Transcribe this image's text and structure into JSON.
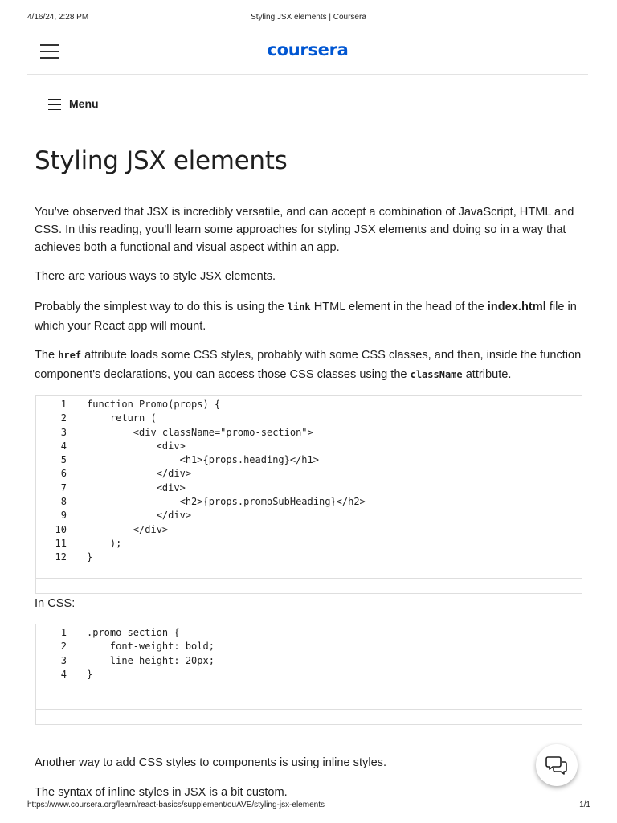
{
  "print_header": {
    "date": "4/16/24, 2:28 PM",
    "title": "Styling JSX elements | Coursera"
  },
  "brand": {
    "logo_text": "coursera",
    "color": "#0056d2"
  },
  "menu": {
    "label": "Menu"
  },
  "page_title": "Styling JSX elements",
  "paragraphs": {
    "p1": "You’ve observed that JSX is incredibly versatile, and can accept a combination of JavaScript, HTML and CSS.  In this reading, you'll learn some approaches for styling JSX elements and doing so in a way that achieves both a functional and visual aspect within an app.",
    "p2": "There are various ways to style JSX elements.",
    "p3": {
      "a": "Probably the simplest way to do this is using the ",
      "code": "link",
      "b": " HTML element in the head of the ",
      "bold": "index.html",
      "c": " file in which your React app will mount."
    },
    "p4": {
      "a": "The ",
      "code1": "href",
      "b": " attribute loads some CSS styles, probably with some CSS classes, and then, inside the function component's declarations, you can access those CSS classes using the ",
      "code2": "className",
      "c": " attribute."
    },
    "in_css": "In CSS:",
    "p5": "Another way to add CSS styles to components is using inline styles.",
    "p6": "The syntax of inline styles in JSX is a bit custom."
  },
  "code_block_1": {
    "lines": [
      {
        "n": "1",
        "t": "function Promo(props) {"
      },
      {
        "n": "2",
        "t": "    return ("
      },
      {
        "n": "3",
        "t": "        <div className=\"promo-section\">"
      },
      {
        "n": "4",
        "t": "            <div>"
      },
      {
        "n": "5",
        "t": "                <h1>{props.heading}</h1>"
      },
      {
        "n": "6",
        "t": "            </div>"
      },
      {
        "n": "7",
        "t": "            <div>"
      },
      {
        "n": "8",
        "t": "                <h2>{props.promoSubHeading}</h2>"
      },
      {
        "n": "9",
        "t": "            </div>"
      },
      {
        "n": "10",
        "t": "        </div>"
      },
      {
        "n": "11",
        "t": "    );"
      },
      {
        "n": "12",
        "t": "}"
      }
    ]
  },
  "code_block_2": {
    "lines": [
      {
        "n": "1",
        "t": ".promo-section {"
      },
      {
        "n": "2",
        "t": "    font-weight: bold;"
      },
      {
        "n": "3",
        "t": "    line-height: 20px;"
      },
      {
        "n": "4",
        "t": "}"
      }
    ]
  },
  "chat_button": {
    "icon": "chat-bubbles-icon"
  },
  "print_footer": {
    "url": "https://www.coursera.org/learn/react-basics/supplement/ouAVE/styling-jsx-elements",
    "page": "1/1"
  }
}
